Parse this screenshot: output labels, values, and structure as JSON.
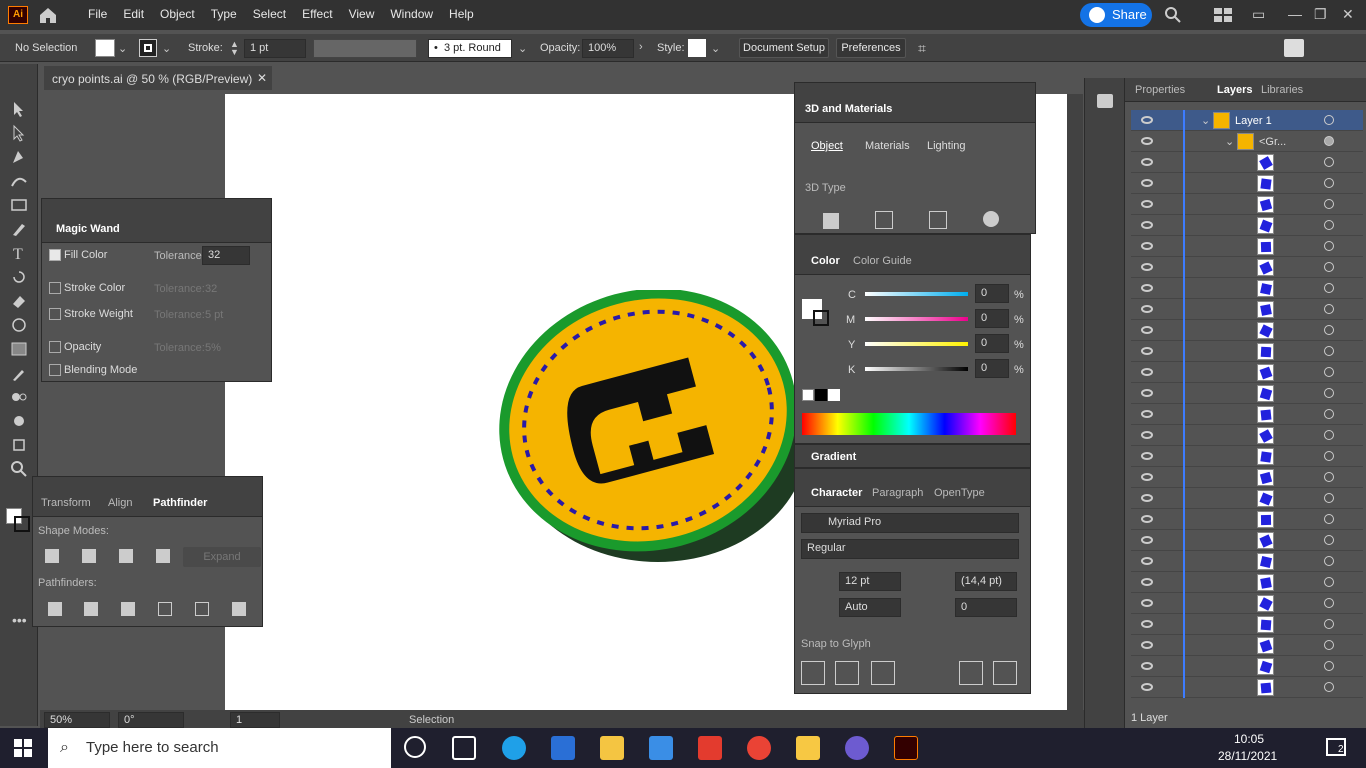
{
  "app": {
    "logo": "Ai",
    "menus": [
      "File",
      "Edit",
      "Object",
      "Type",
      "Select",
      "Effect",
      "View",
      "Window",
      "Help"
    ],
    "share": "Share"
  },
  "control": {
    "selection": "No Selection",
    "stroke_label": "Stroke:",
    "stroke_value": "1 pt",
    "brush": "3 pt. Round",
    "opacity_label": "Opacity:",
    "opacity_value": "100%",
    "style_label": "Style:",
    "doc_setup": "Document Setup",
    "preferences": "Preferences"
  },
  "document": {
    "tab_title": "cryo points.ai @ 50 % (RGB/Preview)",
    "zoom": "50%",
    "rotation": "0°",
    "artboard_num": "1",
    "tool_status": "Selection"
  },
  "magic_wand": {
    "title": "Magic Wand",
    "rows": [
      {
        "label": "Fill Color",
        "checked": true,
        "tol_label": "Tolerance:",
        "tol": "32"
      },
      {
        "label": "Stroke Color",
        "checked": false,
        "tol_label": "Tolerance:",
        "tol": "32"
      },
      {
        "label": "Stroke Weight",
        "checked": false,
        "tol_label": "Tolerance:",
        "tol": "5 pt"
      },
      {
        "label": "Opacity",
        "checked": false,
        "tol_label": "Tolerance:",
        "tol": "5%"
      },
      {
        "label": "Blending Mode",
        "checked": false
      }
    ]
  },
  "pathfinder": {
    "tabs": [
      "Transform",
      "Align",
      "Pathfinder"
    ],
    "shape_modes": "Shape Modes:",
    "expand": "Expand",
    "pathfinders": "Pathfinders:"
  },
  "materials": {
    "title": "3D and Materials",
    "tabs": [
      "Object",
      "Materials",
      "Lighting"
    ],
    "type_label": "3D Type"
  },
  "color": {
    "tabs": [
      "Color",
      "Color Guide"
    ],
    "channels": [
      {
        "label": "C",
        "value": "0",
        "unit": "%"
      },
      {
        "label": "M",
        "value": "0",
        "unit": "%"
      },
      {
        "label": "Y",
        "value": "0",
        "unit": "%"
      },
      {
        "label": "K",
        "value": "0",
        "unit": "%"
      }
    ]
  },
  "gradient": {
    "title": "Gradient"
  },
  "character": {
    "tabs": [
      "Character",
      "Paragraph",
      "OpenType"
    ],
    "font": "Myriad Pro",
    "style": "Regular",
    "size": "12 pt",
    "leading": "(14,4 pt)",
    "kerning": "Auto",
    "tracking": "0",
    "snap": "Snap to Glyph"
  },
  "layers_panel": {
    "tabs": [
      "Properties",
      "Layers",
      "Libraries"
    ],
    "layer_name": "Layer 1",
    "group_name": "<Gr...",
    "footer": "1 Layer",
    "path_rows": 27
  },
  "taskbar": {
    "search_placeholder": "Type here to search",
    "time": "10:05",
    "date": "28/11/2021",
    "notif_count": "2"
  }
}
